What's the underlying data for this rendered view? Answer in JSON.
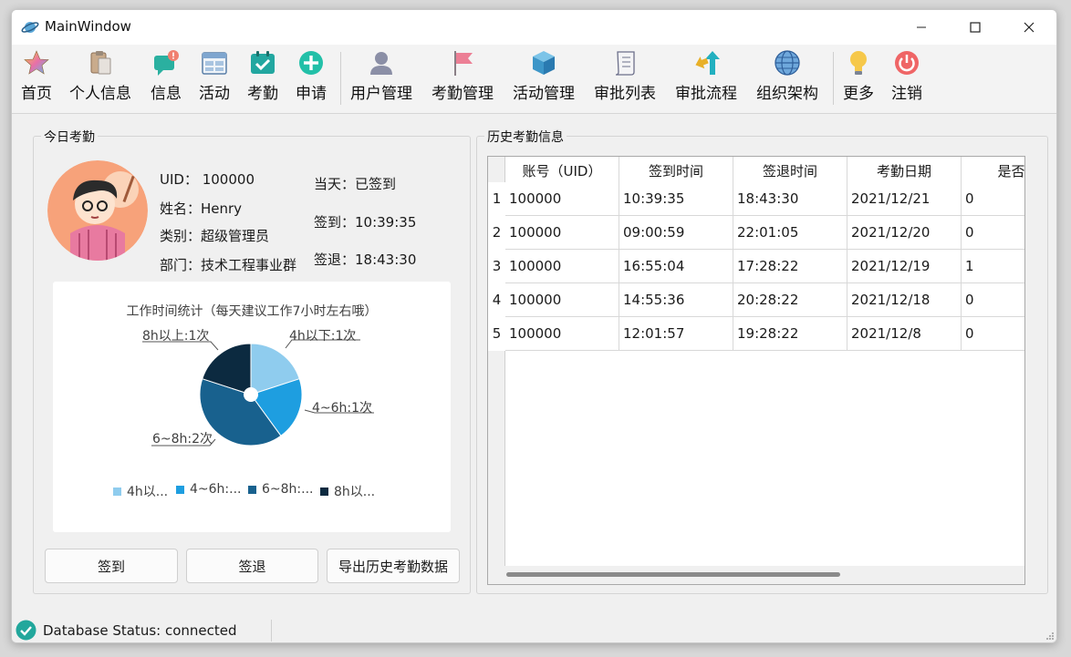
{
  "window": {
    "title": "MainWindow"
  },
  "toolbar": {
    "items": [
      {
        "label": "首页",
        "icon": "star-icon"
      },
      {
        "label": "个人信息",
        "icon": "clipboard-icon"
      },
      {
        "label": "信息",
        "icon": "message-alert-icon"
      },
      {
        "label": "活动",
        "icon": "calendar-grid-icon"
      },
      {
        "label": "考勤",
        "icon": "calendar-check-icon"
      },
      {
        "label": "申请",
        "icon": "plus-circle-icon"
      },
      {
        "label": "用户管理",
        "icon": "user-icon"
      },
      {
        "label": "考勤管理",
        "icon": "flag-icon"
      },
      {
        "label": "活动管理",
        "icon": "cube-icon"
      },
      {
        "label": "审批列表",
        "icon": "document-list-icon"
      },
      {
        "label": "审批流程",
        "icon": "arrows-flow-icon"
      },
      {
        "label": "组织架构",
        "icon": "globe-icon"
      },
      {
        "label": "更多",
        "icon": "lightbulb-icon"
      },
      {
        "label": "注销",
        "icon": "power-icon"
      }
    ]
  },
  "today": {
    "group_title": "今日考勤",
    "uid": "UID：  100000",
    "name": "姓名：Henry",
    "role": "类别：超级管理员",
    "dept": "部门：技术工程事业群",
    "status": "当天：已签到",
    "checkin": "签到：10:39:35",
    "checkout": "签退：18:43:30",
    "pie_title": "工作时间统计（每天建议工作7小时左右哦）",
    "slice_labels": [
      "4h以下:1次",
      "4~6h:1次",
      "6~8h:2次",
      "8h以上:1次"
    ],
    "legend": [
      "4h以...",
      "4~6h:...",
      "6~8h:...",
      "8h以..."
    ],
    "colors": [
      "#8fccee",
      "#1e9ee0",
      "#18618e",
      "#0c2a40"
    ],
    "buttons": {
      "checkin": "签到",
      "checkout": "签退",
      "export": "导出历史考勤数据"
    }
  },
  "chart_data": {
    "type": "pie",
    "title": "工作时间统计（每天建议工作7小时左右哦）",
    "categories": [
      "4h以下",
      "4~6h",
      "6~8h",
      "8h以上"
    ],
    "values": [
      1,
      1,
      2,
      1
    ],
    "legend_position": "bottom"
  },
  "history": {
    "group_title": "历史考勤信息",
    "columns": [
      "账号（UID）",
      "签到时间",
      "签退时间",
      "考勤日期",
      "是否补"
    ],
    "rows": [
      [
        "1",
        "100000",
        "10:39:35",
        "18:43:30",
        "2021/12/21",
        "0"
      ],
      [
        "2",
        "100000",
        "09:00:59",
        "22:01:05",
        "2021/12/20",
        "0"
      ],
      [
        "3",
        "100000",
        "16:55:04",
        "17:28:22",
        "2021/12/19",
        "1"
      ],
      [
        "4",
        "100000",
        "14:55:36",
        "20:28:22",
        "2021/12/18",
        "0"
      ],
      [
        "5",
        "100000",
        "12:01:57",
        "19:28:22",
        "2021/12/8",
        "0"
      ]
    ]
  },
  "status": {
    "text": "Database Status: connected"
  }
}
